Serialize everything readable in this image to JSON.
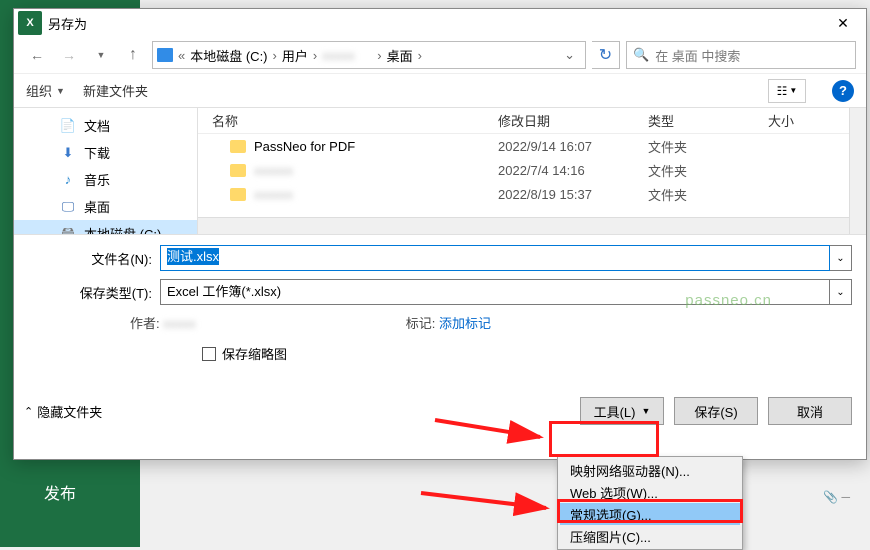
{
  "window": {
    "title": "另存为"
  },
  "bg": {
    "publish": "发布"
  },
  "breadcrumb": {
    "parts": [
      "本地磁盘 (C:)",
      "用户",
      "",
      "桌面"
    ],
    "refresh": "↻"
  },
  "search": {
    "placeholder": "在 桌面 中搜索"
  },
  "toolbar": {
    "organize": "组织",
    "newfolder": "新建文件夹"
  },
  "tree": [
    {
      "icon": "📄",
      "label": "文档",
      "color": "#4a8bd4"
    },
    {
      "icon": "⬇",
      "label": "下载",
      "color": "#3a7acc"
    },
    {
      "icon": "♪",
      "label": "音乐",
      "color": "#2f8cd1"
    },
    {
      "icon": "🖵",
      "label": "桌面",
      "color": "#3a6cb0"
    },
    {
      "icon": "🖴",
      "label": "本地磁盘 (C:)",
      "color": "#777",
      "selected": true
    }
  ],
  "columns": {
    "name": "名称",
    "date": "修改日期",
    "type": "类型",
    "size": "大小"
  },
  "rows": [
    {
      "name": "PassNeo for PDF",
      "date": "2022/9/14 16:07",
      "type": "文件夹"
    },
    {
      "name": "blur1",
      "date": "2022/7/4 14:16",
      "type": "文件夹",
      "blur": true
    },
    {
      "name": "blur2",
      "date": "2022/8/19 15:37",
      "type": "文件夹",
      "blur": true
    }
  ],
  "fields": {
    "filename_label": "文件名(N):",
    "filename_value": "测试.xlsx",
    "filetype_label": "保存类型(T):",
    "filetype_value": "Excel 工作簿(*.xlsx)",
    "author_label": "作者:",
    "tags_label": "标记:",
    "tags_value": "添加标记",
    "thumb_label": "保存缩略图"
  },
  "footer": {
    "hide": "隐藏文件夹",
    "tools": "工具(L)",
    "save": "保存(S)",
    "cancel": "取消"
  },
  "menu": [
    "映射网络驱动器(N)...",
    "Web 选项(W)...",
    "常规选项(G)...",
    "压缩图片(C)..."
  ],
  "watermark": "passneo.cn"
}
